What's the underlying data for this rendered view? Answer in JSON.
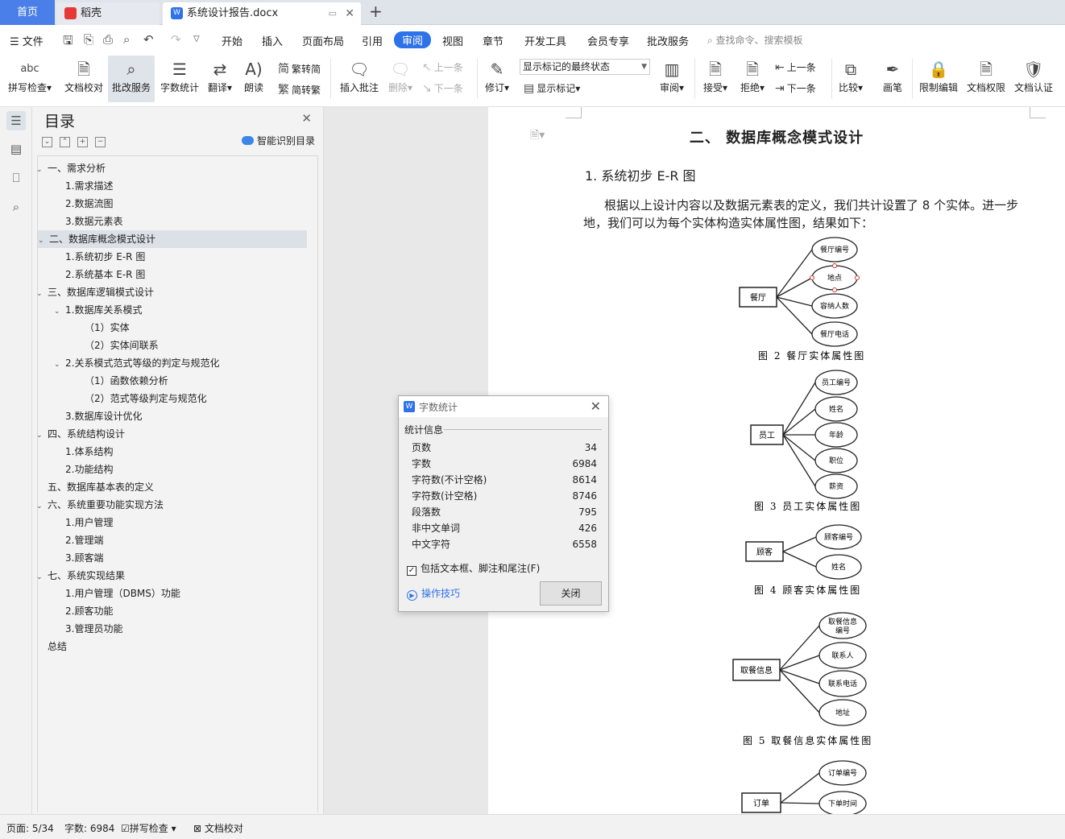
{
  "tabs": {
    "home": "首页",
    "daoke": "稻壳",
    "doc": "系统设计报告.docx",
    "new": "+"
  },
  "menu": {
    "file": "文件",
    "items": [
      "开始",
      "插入",
      "页面布局",
      "引用",
      "审阅",
      "视图",
      "章节",
      "开发工具",
      "会员专享",
      "批改服务"
    ],
    "active": "审阅",
    "search": "查找命令、搜索模板"
  },
  "ribbon": {
    "spell": "拼写检查",
    "proof": "文档校对",
    "correct": "批改服务",
    "wordcount": "字数统计",
    "translate": "翻译",
    "read": "朗读",
    "trad": "繁转简",
    "simp": "简转繁",
    "insert_comment": "插入批注",
    "delete": "删除",
    "prev": "上一条",
    "next": "下一条",
    "revise": "修订",
    "markup_select": "显示标记的最终状态",
    "show_markup": "显示标记",
    "review": "审阅",
    "accept": "接受",
    "reject": "拒绝",
    "prev2": "上一条",
    "next2": "下一条",
    "compare": "比较",
    "pen": "画笔",
    "restrict": "限制编辑",
    "rights": "文档权限",
    "certify": "文档认证",
    "abc": "abc"
  },
  "toc": {
    "title": "目录",
    "smart": "智能识别目录",
    "items": [
      {
        "label": "一、需求分析",
        "level": 1,
        "caret": true
      },
      {
        "label": "1.需求描述",
        "level": 2
      },
      {
        "label": "2.数据流图",
        "level": 2
      },
      {
        "label": "3.数据元素表",
        "level": 2
      },
      {
        "label": "二、数据库概念模式设计",
        "level": 1,
        "caret": true,
        "selected": true
      },
      {
        "label": "1.系统初步 E-R 图",
        "level": 2
      },
      {
        "label": "2.系统基本 E-R 图",
        "level": 2
      },
      {
        "label": "三、数据库逻辑模式设计",
        "level": 1,
        "caret": true
      },
      {
        "label": "1.数据库关系模式",
        "level": 2,
        "caret": true
      },
      {
        "label": "（1）实体",
        "level": 3
      },
      {
        "label": "（2）实体间联系",
        "level": 3
      },
      {
        "label": "2.关系模式范式等级的判定与规范化",
        "level": 2,
        "caret": true
      },
      {
        "label": "（1）函数依赖分析",
        "level": 3
      },
      {
        "label": "（2）范式等级判定与规范化",
        "level": 3
      },
      {
        "label": "3.数据库设计优化",
        "level": 2
      },
      {
        "label": "四、系统结构设计",
        "level": 1,
        "caret": true
      },
      {
        "label": "1.体系结构",
        "level": 2
      },
      {
        "label": "2.功能结构",
        "level": 2
      },
      {
        "label": "五、数据库基本表的定义",
        "level": 1
      },
      {
        "label": "六、系统重要功能实现方法",
        "level": 1,
        "caret": true
      },
      {
        "label": "1.用户管理",
        "level": 2
      },
      {
        "label": "2.管理端",
        "level": 2
      },
      {
        "label": "3.顾客端",
        "level": 2
      },
      {
        "label": "七、系统实现结果",
        "level": 1,
        "caret": true
      },
      {
        "label": "1.用户管理（DBMS）功能",
        "level": 2
      },
      {
        "label": "2.顾客功能",
        "level": 2
      },
      {
        "label": "3.管理员功能",
        "level": 2
      },
      {
        "label": "总结",
        "level": 1
      }
    ]
  },
  "doc": {
    "h2": "二、  数据库概念模式设计",
    "h3": "1. 系统初步 E-R 图",
    "para": "根据以上设计内容以及数据元素表的定义，我们共计设置了 8 个实体。进一步地，我们可以为每个实体构造实体属性图，结果如下：",
    "figures": [
      {
        "entity": "餐厅",
        "attrs": [
          "餐厅编号",
          "地点",
          "容纳人数",
          "餐厅电话"
        ],
        "caption": "图 2  餐厅实体属性图"
      },
      {
        "entity": "员工",
        "attrs": [
          "员工编号",
          "姓名",
          "年龄",
          "职位",
          "薪资"
        ],
        "caption": "图 3  员工实体属性图"
      },
      {
        "entity": "顾客",
        "attrs": [
          "顾客编号",
          "姓名"
        ],
        "caption": "图 4  顾客实体属性图"
      },
      {
        "entity": "取餐信息",
        "attrs": [
          "取餐信息编号",
          "联系人",
          "联系电话",
          "地址"
        ],
        "caption": "图 5  取餐信息实体属性图"
      },
      {
        "entity": "订单",
        "attrs": [
          "订单编号",
          "下单时间"
        ],
        "caption": ""
      }
    ]
  },
  "dialog": {
    "title": "字数统计",
    "section": "统计信息",
    "rows": [
      {
        "label": "页数",
        "value": "34"
      },
      {
        "label": "字数",
        "value": "6984"
      },
      {
        "label": "字符数(不计空格)",
        "value": "8614"
      },
      {
        "label": "字符数(计空格)",
        "value": "8746"
      },
      {
        "label": "段落数",
        "value": "795"
      },
      {
        "label": "非中文单词",
        "value": "426"
      },
      {
        "label": "中文字符",
        "value": "6558"
      }
    ],
    "include": "包括文本框、脚注和尾注(F)",
    "include_checked": true,
    "tips": "操作技巧",
    "close": "关闭"
  },
  "status": {
    "page": "页面: 5/34",
    "words": "字数: 6984",
    "spell": "拼写检查",
    "proof": "文档校对"
  }
}
